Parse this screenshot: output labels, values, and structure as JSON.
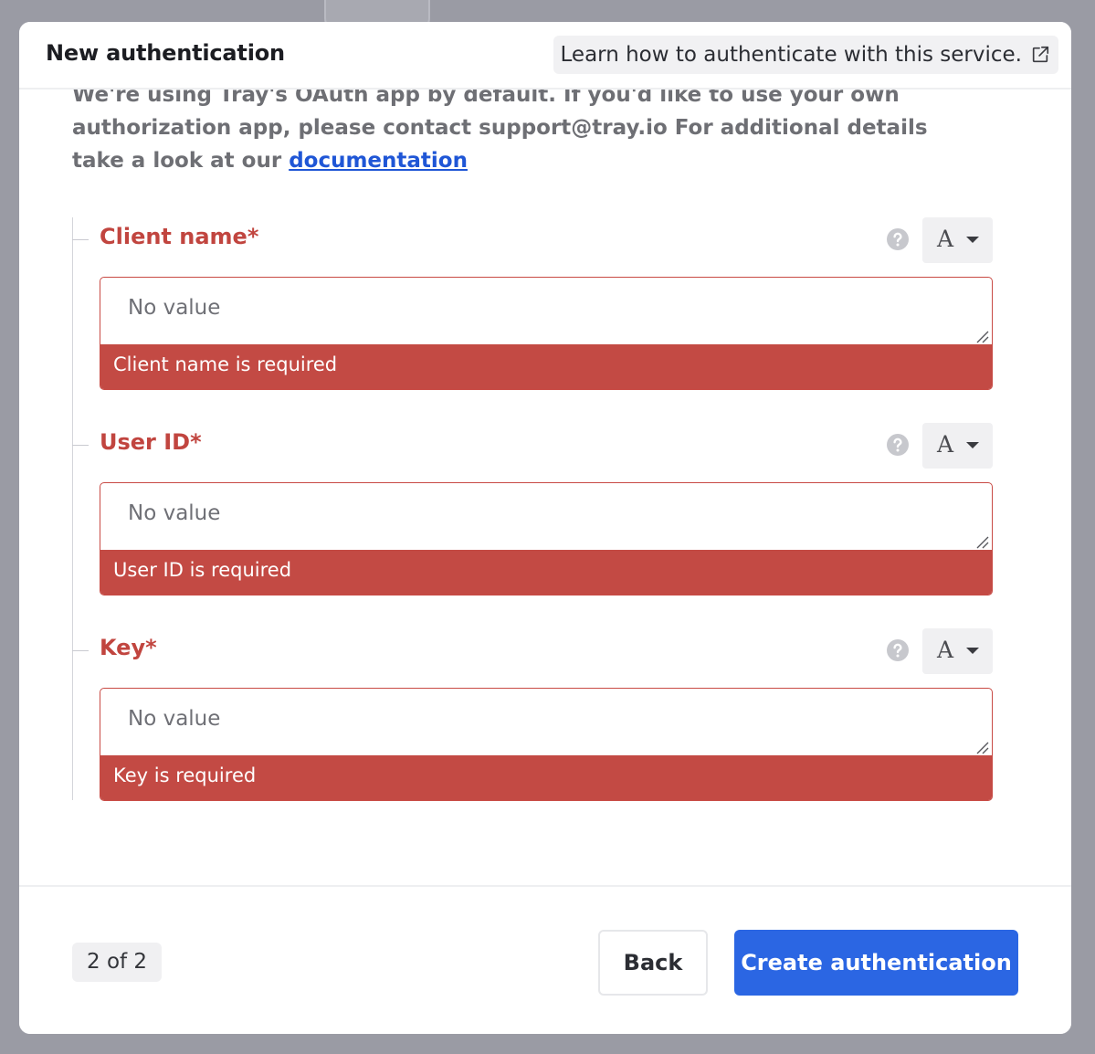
{
  "modal": {
    "title": "New authentication",
    "learn_link": "Learn how to authenticate with this service.",
    "intro_text": "We're using Tray's OAuth app by default. If you'd like to use your own authorization app, please contact support@tray.io For additional details take a look at our",
    "intro_link": "documentation"
  },
  "fields": [
    {
      "label": "Client name*",
      "placeholder": "No value",
      "error": "Client name is required",
      "type_letter": "A"
    },
    {
      "label": "User ID*",
      "placeholder": "No value",
      "error": "User ID is required",
      "type_letter": "A"
    },
    {
      "label": "Key*",
      "placeholder": "No value",
      "error": "Key is required",
      "type_letter": "A"
    }
  ],
  "footer": {
    "step": "2 of 2",
    "back_label": "Back",
    "create_label": "Create authentication"
  },
  "colors": {
    "error": "#c34a44",
    "primary": "#2b66e3",
    "link": "#1f56d6"
  }
}
